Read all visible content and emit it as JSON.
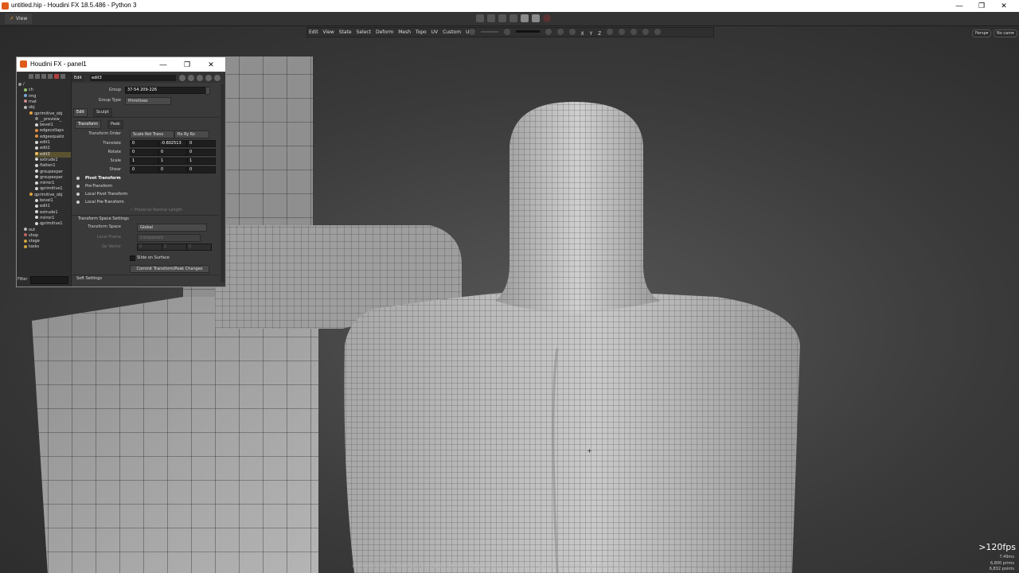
{
  "window": {
    "title": "untitled.hip - Houdini FX 18.5.486 - Python 3",
    "min_glyph": "—",
    "max_glyph": "❐",
    "close_glyph": "✕"
  },
  "desktop_tab": {
    "arrow": "↗",
    "label": "View"
  },
  "viewport": {
    "menu": [
      "Edit",
      "View",
      "State",
      "Select",
      "Deform",
      "Mesh",
      "Topo",
      "UV",
      "Custom",
      "UI"
    ],
    "persp_label": "Persp▾",
    "cam_label": "No cam▾",
    "axis_labels": [
      "X",
      "Y",
      "Z"
    ],
    "fps": ">120fps",
    "fps_time": "7.49ms",
    "prims": "6,800  prims",
    "points": "6,832  points",
    "hint": "Left mouse tumbles. Middle pans. Right dollies. Ctrl+Alt+Left box-zooms. Ctrl+Right zooms. Spacebar-Ctrl-Left tilts. Hold L for alternate tumble, dolly, and zoom."
  },
  "panel": {
    "title": "Houdini FX - panel1",
    "tree": [
      {
        "label": "/",
        "indent": 0,
        "color": "#9a9a9a"
      },
      {
        "label": "ch",
        "indent": 1,
        "color": "#8fc26a"
      },
      {
        "label": "img",
        "indent": 1,
        "color": "#7aa7d8"
      },
      {
        "label": "mat",
        "indent": 1,
        "color": "#c98a8a"
      },
      {
        "label": "obj",
        "indent": 1,
        "color": "#b8b8b8"
      },
      {
        "label": "qprimitive_obj",
        "indent": 2,
        "color": "#e0a040"
      },
      {
        "label": "__preview_",
        "indent": 3,
        "color": "#888"
      },
      {
        "label": "bevel1",
        "indent": 3,
        "color": "#d8d8d8"
      },
      {
        "label": "edgecollaps",
        "indent": 3,
        "color": "#e09040"
      },
      {
        "label": "edgeequaliz",
        "indent": 3,
        "color": "#e09040"
      },
      {
        "label": "edit1",
        "indent": 3,
        "color": "#d8d8d8"
      },
      {
        "label": "edit2",
        "indent": 3,
        "color": "#d8d8d8"
      },
      {
        "label": "edit3",
        "indent": 3,
        "color": "#f0c060",
        "selected": true
      },
      {
        "label": "extrude1",
        "indent": 3,
        "color": "#d8d8d8"
      },
      {
        "label": "flatten1",
        "indent": 3,
        "color": "#d8d8d8"
      },
      {
        "label": "groupexpar",
        "indent": 3,
        "color": "#d8d8d8"
      },
      {
        "label": "groupexpar",
        "indent": 3,
        "color": "#d8d8d8"
      },
      {
        "label": "mirror1",
        "indent": 3,
        "color": "#d8d8d8"
      },
      {
        "label": "qprimitive1",
        "indent": 3,
        "color": "#d8d8d8"
      },
      {
        "label": "qprimitive_obj",
        "indent": 2,
        "color": "#e0a040"
      },
      {
        "label": "bevel1",
        "indent": 3,
        "color": "#d8d8d8"
      },
      {
        "label": "edit1",
        "indent": 3,
        "color": "#d8d8d8"
      },
      {
        "label": "extrude1",
        "indent": 3,
        "color": "#d8d8d8"
      },
      {
        "label": "mirror1",
        "indent": 3,
        "color": "#d8d8d8"
      },
      {
        "label": "qprimitive1",
        "indent": 3,
        "color": "#d8d8d8"
      },
      {
        "label": "out",
        "indent": 1,
        "color": "#b8b8b8"
      },
      {
        "label": "shop",
        "indent": 1,
        "color": "#c06060"
      },
      {
        "label": "stage",
        "indent": 1,
        "color": "#d0a040"
      },
      {
        "label": "tasks",
        "indent": 1,
        "color": "#d0a040"
      }
    ],
    "filter_label": "Filter",
    "params": {
      "edit_tag": "Edit",
      "node_name": "edit3",
      "group_label": "Group",
      "group_value": "37-54 209-226",
      "group_type_label": "Group Type",
      "group_type_value": "Primitives",
      "tab_edit": "Edit",
      "tab_sculpt": "Sculpt",
      "tab_transform": "Transform",
      "tab_peak": "Peak",
      "transform_order_label": "Transform Order",
      "transform_order_value": "Scale Rot Trans",
      "rot_order_value": "Rx Ry Rz",
      "translate_label": "Translate",
      "translate": [
        "0",
        "-0.602513",
        "0"
      ],
      "rotate_label": "Rotate",
      "rotate": [
        "0",
        "0",
        "0"
      ],
      "scale_label": "Scale",
      "scale": [
        "1",
        "1",
        "1"
      ],
      "shear_label": "Shear",
      "shear": [
        "0",
        "0",
        "0"
      ],
      "pivot_transform": "Pivot Transform",
      "pre_transform": "Pre-Transform",
      "local_pivot_transform": "Local Pivot Transform",
      "local_pre_transform": "Local Pre-Transform",
      "preserve_normal": "Preserve Normal Length",
      "transform_space_settings": "Transform Space Settings",
      "transform_space_label": "Transform Space",
      "transform_space_value": "Global",
      "local_frame_label": "Local Frame",
      "local_frame_value": "Component",
      "up_vector_label": "Up Vector",
      "up_vector": [
        "0",
        "1",
        "0"
      ],
      "slide_on_surface": "Slide on Surface",
      "commit_button": "Commit Transform/Peak Changes",
      "soft_settings": "Soft Settings"
    }
  }
}
